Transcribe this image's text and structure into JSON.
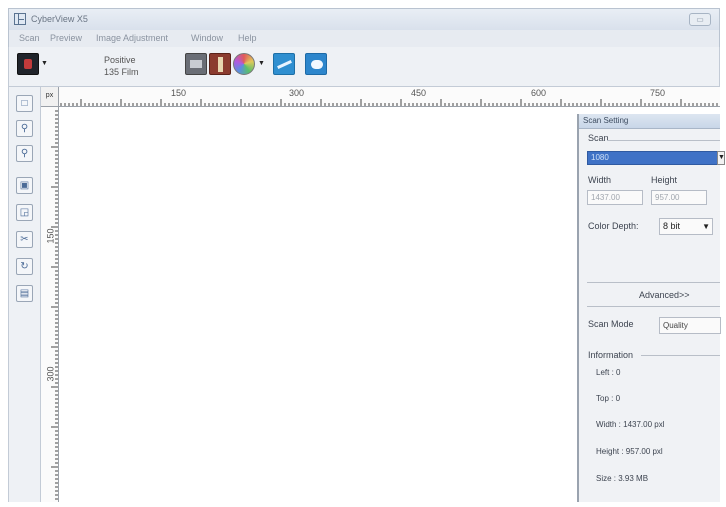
{
  "window": {
    "title": "CyberView X5",
    "close_glyph": "▭"
  },
  "menu": [
    "Scan",
    "Preview",
    "Image Adjustment",
    "Window",
    "Help"
  ],
  "toolbar": {
    "film_type_line1": "Positive",
    "film_type_line2": "135 Film"
  },
  "ruler": {
    "horizontal": [
      "150",
      "300",
      "450",
      "600",
      "750"
    ],
    "vertical": [
      "150",
      "300"
    ],
    "unit": "px"
  },
  "scan_setting": {
    "title": "Scan Setting",
    "scan_group_label": "Scan",
    "scan_value": "1080",
    "width_label": "Width",
    "height_label": "Height",
    "width_value": "1437.00",
    "height_value": "957.00",
    "color_depth_label": "Color Depth:",
    "color_depth_value": "8 bit",
    "advanced_label": "Advanced>>",
    "scan_mode_label": "Scan Mode",
    "scan_mode_value": "Quality",
    "information_label": "Information",
    "info": {
      "left": "Left : 0",
      "top": "Top : 0",
      "width": "Width : 1437.00 pxl",
      "height": "Height : 957.00 pxl",
      "size": "Size : 3.93 MB"
    }
  },
  "colors": {
    "accent": "#3f72c6",
    "panel_bg": "#f0f2f5"
  }
}
